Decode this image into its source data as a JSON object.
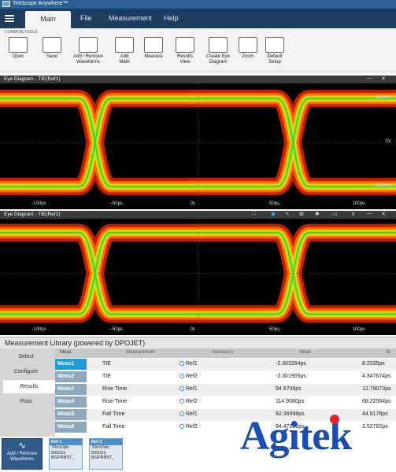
{
  "app": {
    "title": "TekScope Anywhere™"
  },
  "menu": {
    "items": [
      "Main",
      "File",
      "Measurement",
      "Help"
    ],
    "active": "Main"
  },
  "toolbar": {
    "caption": "COMMON TOOLS",
    "tools": [
      {
        "label": "Open",
        "icon": "folder-icon"
      },
      {
        "label": "Save",
        "icon": "save-icon"
      },
      {
        "label": "Add / Remove\nWaveforms",
        "icon": "waveform-icon"
      },
      {
        "label": "Add\nMath",
        "icon": "math-icon"
      },
      {
        "label": "Measure",
        "icon": "measure-icon"
      },
      {
        "label": "Results\nView",
        "icon": "results-icon"
      },
      {
        "label": "Create Eye\nDiagram",
        "icon": "eye-icon"
      },
      {
        "label": "Zoom",
        "icon": "zoom-icon"
      },
      {
        "label": "Default\nSetup",
        "icon": "default-setup-icon"
      }
    ]
  },
  "eye1": {
    "title": "Eye Diagram - TIE(Ref1)",
    "xticks": [
      "-100ps",
      "-50ps",
      "0s",
      "50ps",
      "100ps"
    ],
    "yticks": [
      "200mV",
      "0V",
      "-200mV"
    ]
  },
  "eye2": {
    "title": "Eye Diagram - TIE(Ref2)",
    "xticks": [
      "-100ps",
      "-50ps",
      "0s",
      "50ps",
      "100ps"
    ]
  },
  "library": {
    "title": "Measurement Library (powered by DPOJET)",
    "tabs": [
      "Select",
      "Configure",
      "Results",
      "Plots"
    ],
    "active_tab": "Results",
    "columns": [
      "Meas",
      "Measurement",
      "Source(s)",
      "Mean",
      "St"
    ],
    "rows": [
      {
        "meas": "Meas1",
        "measurement": "TIE",
        "source": "Ref1",
        "mean": "-2.303264ps",
        "std": "8.2535ps"
      },
      {
        "meas": "Meas2",
        "measurement": "TIE",
        "source": "Ref2",
        "mean": "-2.301905ps",
        "std": "4.347674ps"
      },
      {
        "meas": "Meas3",
        "measurement": "Rise Time",
        "source": "Ref1",
        "mean": "94.8706ps",
        "std": "12.79073ps"
      },
      {
        "meas": "Meas4",
        "measurement": "Rise Time",
        "source": "Ref2",
        "mean": "114.9580ps",
        "std": "68.22564ps"
      },
      {
        "meas": "Meas5",
        "measurement": "Fall Time",
        "source": "Ref1",
        "mean": "92.36998ps",
        "std": "44.9178ps"
      },
      {
        "meas": "Meas6",
        "measurement": "Fall Time",
        "source": "Ref2",
        "mean": "94.47096ps",
        "std": "3.52782ps"
      }
    ]
  },
  "bottom": {
    "add_button": "Add / Remove\nWaveforms",
    "refs": [
      {
        "name": "Ref 1",
        "lines": [
          "70mV/div",
          "50GS/s",
          "BGPRBS7_"
        ]
      },
      {
        "name": "Ref 2",
        "lines": [
          "70mV/div",
          "50GS/s",
          "BGPRBS7_"
        ]
      }
    ]
  },
  "watermark": "Agitek"
}
